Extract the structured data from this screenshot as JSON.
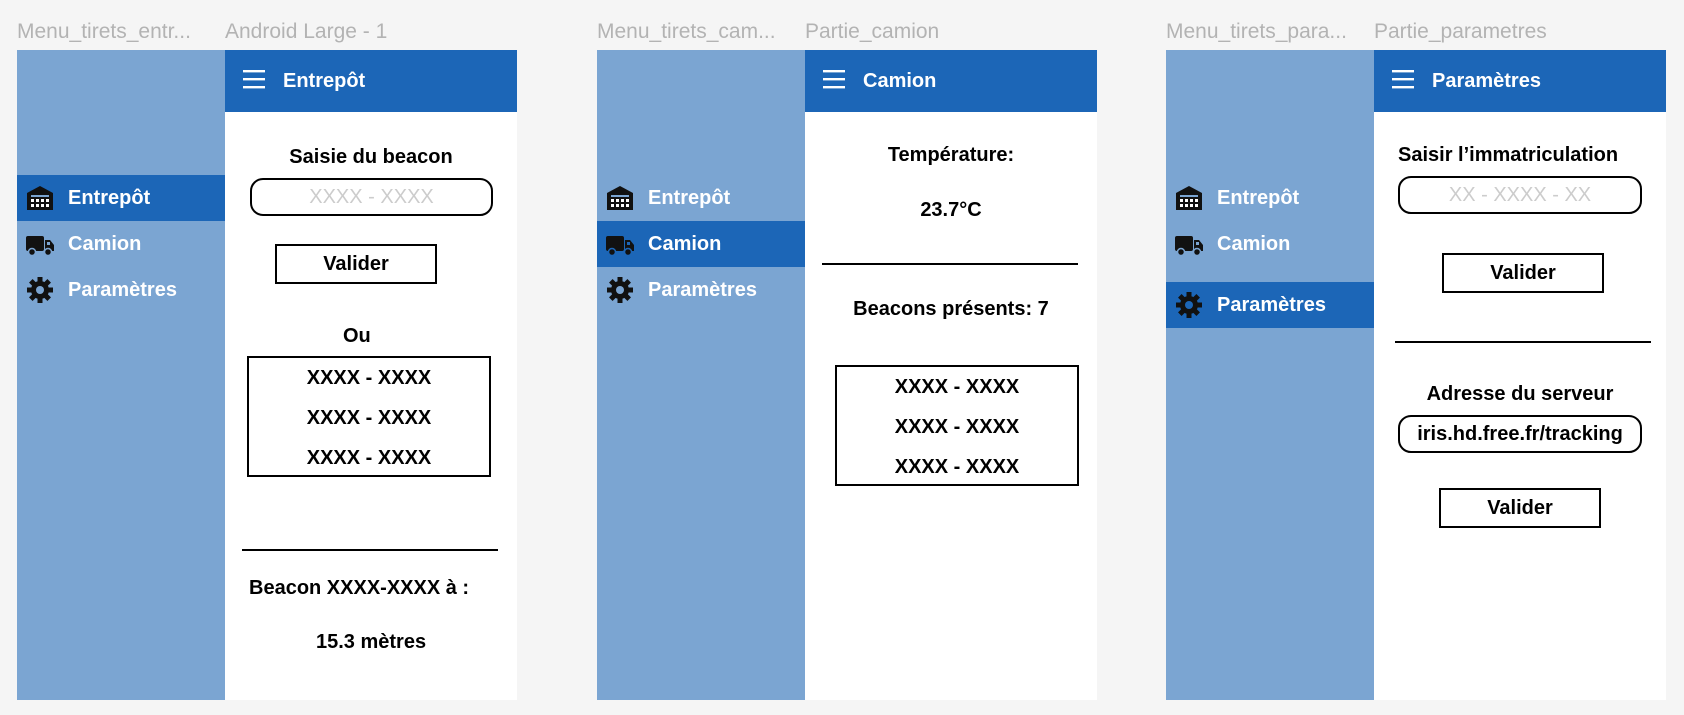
{
  "frames": {
    "f1_drawer_label": "Menu_tirets_entr...",
    "f1_screen_label": "Android Large - 1",
    "f2_drawer_label": "Menu_tirets_cam...",
    "f2_screen_label": "Partie_camion",
    "f3_drawer_label": "Menu_tirets_para...",
    "f3_screen_label": "Partie_parametres"
  },
  "drawer_items": {
    "entrepot": "Entrepôt",
    "camion": "Camion",
    "parametres": "Paramètres"
  },
  "icons": {
    "menu": "hamburger-icon",
    "entrepot": "warehouse-icon",
    "camion": "truck-icon",
    "parametres": "gear-icon"
  },
  "colors": {
    "appbar": "#1c66b7",
    "drawer_bg": "#7ba5d2",
    "drawer_active": "#1c66b7"
  },
  "entrepot_screen": {
    "title": "Entrepôt",
    "beacon_label": "Saisie du beacon",
    "beacon_placeholder": "XXXX - XXXX",
    "validate": "Valider",
    "or": "Ou",
    "beacons": [
      "XXXX - XXXX",
      "XXXX - XXXX",
      "XXXX - XXXX"
    ],
    "distance_label": "Beacon XXXX-XXXX à :",
    "distance_value": "15.3 mètres"
  },
  "camion_screen": {
    "title": "Camion",
    "temperature_label": "Température:",
    "temperature_value": "23.7°C",
    "beacons_present": "Beacons présents: 7",
    "beacons": [
      "XXXX - XXXX",
      "XXXX - XXXX",
      "XXXX - XXXX"
    ]
  },
  "parametres_screen": {
    "title": "Paramètres",
    "plate_label": "Saisir l’immatriculation",
    "plate_placeholder": "XX - XXXX - XX",
    "validate_1": "Valider",
    "server_label": "Adresse du serveur",
    "server_value": "iris.hd.free.fr/tracking",
    "validate_2": "Valider"
  }
}
